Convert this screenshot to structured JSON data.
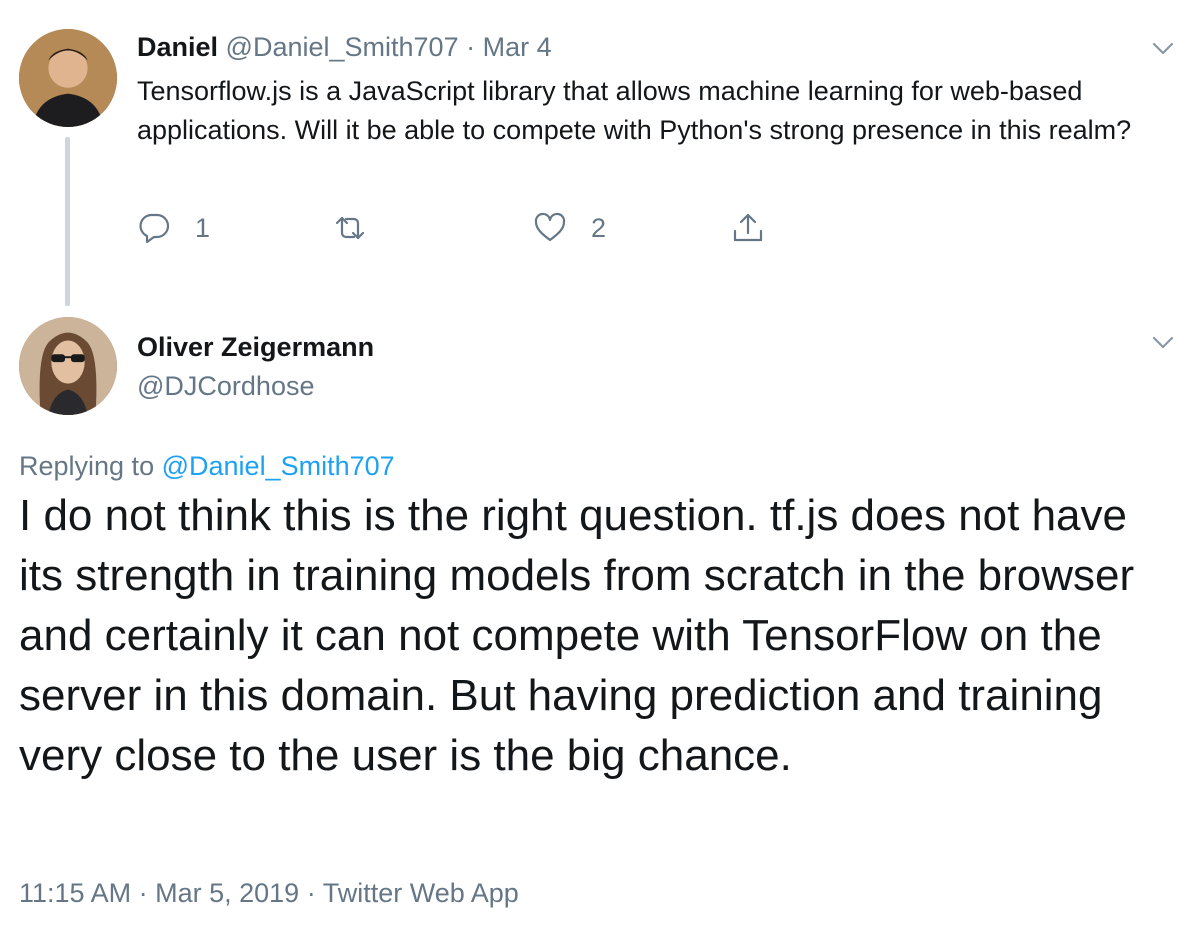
{
  "tweet1": {
    "author_name": "Daniel",
    "handle": "@Daniel_Smith707",
    "separator": "·",
    "date": "Mar 4",
    "text": "Tensorflow.js is a JavaScript library that allows machine learning for web-based applications.  Will it be able to compete with Python's strong presence in this realm?",
    "reply_count": "1",
    "like_count": "2",
    "icons": [
      "reply-icon",
      "retweet-icon",
      "like-icon",
      "share-icon",
      "chevron-down-icon"
    ]
  },
  "tweet2": {
    "author_name": "Oliver Zeigermann",
    "handle": "@DJCordhose",
    "replying_prefix": "Replying to",
    "replying_handle": "@Daniel_Smith707",
    "text": "I do not think this is the right question. tf.js does not have its strength in training models from scratch in the browser and certainly it can not compete with TensorFlow on the server in this domain. But having prediction and training very close to the user is the big chance.",
    "time": "11:15 AM",
    "separator": "·",
    "date": "Mar 5, 2019",
    "source": "Twitter Web App"
  },
  "colors": {
    "text": "#14171a",
    "muted": "#657786",
    "link": "#1da1f2",
    "thread_line": "#ccd6dd"
  }
}
